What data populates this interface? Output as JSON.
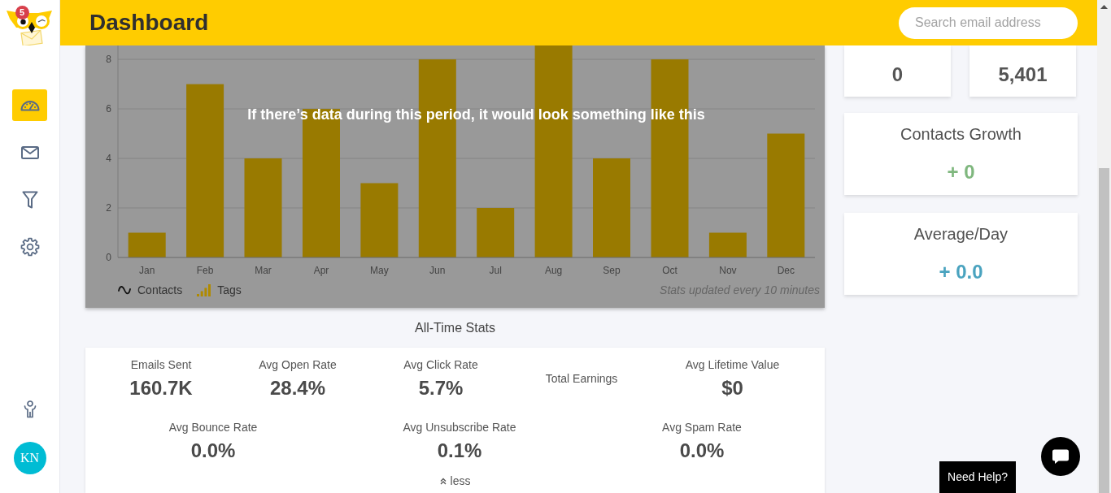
{
  "sidebar": {
    "logo": {
      "badge": "5"
    },
    "nav": [
      {
        "kind": "dashboard",
        "selected": true
      },
      {
        "kind": "mail",
        "selected": false
      },
      {
        "kind": "filter",
        "selected": false
      },
      {
        "kind": "settings",
        "selected": false
      }
    ],
    "bottom_nav": [
      {
        "kind": "person"
      }
    ],
    "avatar": {
      "initials": "KN"
    }
  },
  "header": {
    "title": "Dashboard",
    "search": {
      "placeholder": "Search email address"
    }
  },
  "chart_panel": {
    "message": "If there’s data during this period, it would look something like this",
    "chart_data": {
      "type": "bar",
      "categories": [
        "Jan",
        "Feb",
        "Mar",
        "Apr",
        "May",
        "Jun",
        "Jul",
        "Aug",
        "Sep",
        "Oct",
        "Nov",
        "Dec"
      ],
      "series": [
        {
          "name": "Tags",
          "color": "#997a00",
          "values": [
            1,
            7,
            4,
            6,
            3,
            8,
            2,
            8.56,
            4,
            8,
            1,
            5
          ]
        }
      ],
      "ylim": [
        0,
        8.56
      ],
      "yticks": [
        0,
        2,
        4,
        6,
        8
      ],
      "grid": true
    },
    "legend": [
      {
        "label": "Contacts",
        "kind": "line"
      }
    ],
    "note": "Stats updated every 10 minutes"
  },
  "summary_cards": [
    {
      "value": "0"
    },
    {
      "value": "5,401"
    }
  ],
  "metric_cards": [
    {
      "title": "Contacts Growth",
      "value": "+ 0",
      "color": "#7fb77e"
    },
    {
      "title": "Average/Day",
      "value": "+ 0.0",
      "color": "#4aa3bf"
    }
  ],
  "all_time_stats": {
    "title": "All-Time Stats",
    "top_stats": [
      {
        "label": "Emails Sent",
        "value": "160.7K"
      },
      {
        "label": "Avg Open Rate",
        "value": "28.4%"
      },
      {
        "label": "Avg Click Rate",
        "value": "5.7%"
      },
      {
        "label": "Total Earnings"
      },
      {
        "label": "Avg Lifetime Value",
        "value": "$0"
      }
    ],
    "bottom_stats": [
      {
        "label": "Avg Bounce Rate",
        "value": "0.0%"
      },
      {
        "label": "Avg Unsubscribe Rate",
        "value": "0.1%"
      },
      {
        "label": "Avg Spam Rate",
        "value": "0.0%"
      }
    ],
    "toggle": {
      "label": "less"
    }
  },
  "help": {
    "label": "Need Help?"
  }
}
